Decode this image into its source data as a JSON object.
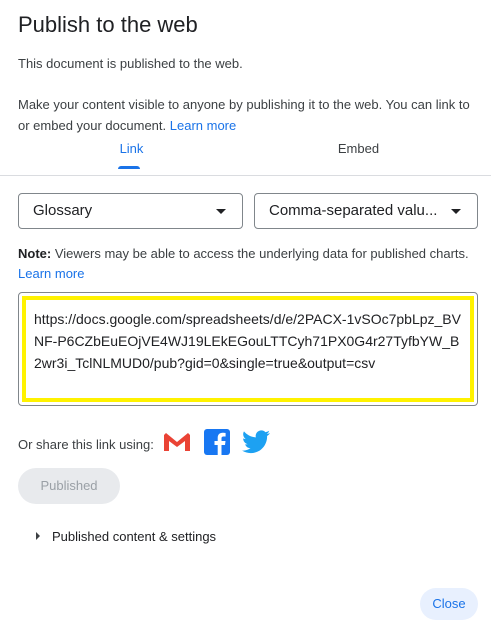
{
  "dialog": {
    "title": "Publish to the web",
    "status": "This document is published to the web.",
    "description": "Make your content visible to anyone by publishing it to the web. You can link to or embed your document.",
    "learn_more": "Learn more"
  },
  "tabs": [
    {
      "label": "Link",
      "active": true
    },
    {
      "label": "Embed",
      "active": false
    }
  ],
  "selects": {
    "sheet": {
      "value": "Glossary"
    },
    "format": {
      "value": "Comma-separated valu..."
    }
  },
  "note": {
    "prefix": "Note:",
    "text": " Viewers may be able to access the underlying data for published charts.",
    "learn_more": "Learn more"
  },
  "url": {
    "value": "https://docs.google.com/spreadsheets/d/e/2PACX-1vSOc7pbLpz_BVNF-P6CZbEuEOjVE4WJ19LEkEGouLTTCyh71PX0G4r27TyfbYW_B2wr3i_TclNLMUD0/pub?gid=0&single=true&output=csv"
  },
  "share": {
    "label": "Or share this link using:",
    "icons": [
      "gmail-icon",
      "facebook-icon",
      "twitter-icon"
    ]
  },
  "buttons": {
    "published": "Published",
    "close": "Close"
  },
  "settings": {
    "label": "Published content & settings"
  },
  "colors": {
    "accent": "#1a73e8",
    "highlight": "#fff200",
    "gmail_red": "#ea4335",
    "facebook_blue": "#1877f2",
    "twitter_blue": "#1da1f2"
  }
}
